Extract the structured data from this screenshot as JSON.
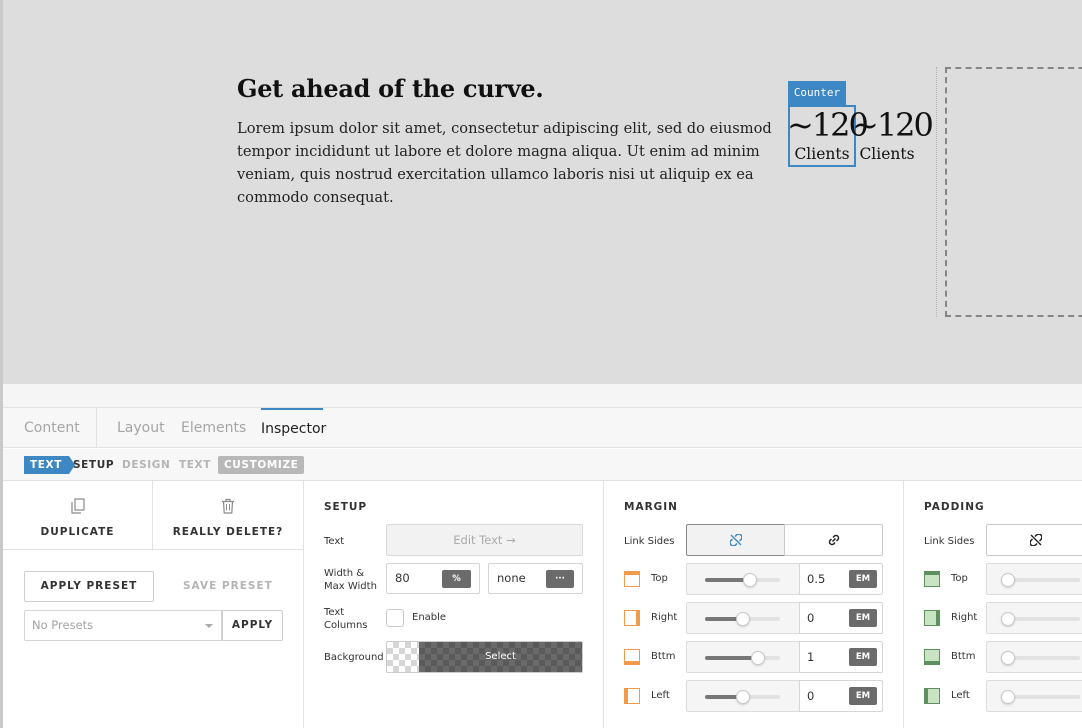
{
  "canvas": {
    "headline": "Get ahead of the curve.",
    "body": "Lorem ipsum dolor sit amet, consectetur adipiscing elit, sed do eiusmod tempor incididunt ut labore et dolore magna aliqua. Ut enim ad minim veniam, quis nostrud exercitation ullamco laboris nisi ut aliquip ex ea commodo consequat.",
    "selected_tag": "Counter",
    "counters": [
      {
        "number": "~120",
        "label": "Clients"
      },
      {
        "number": "~120",
        "label": "Clients"
      }
    ]
  },
  "tabs": [
    {
      "label": "Content"
    },
    {
      "label": "Layout"
    },
    {
      "label": "Elements"
    },
    {
      "label": "Inspector",
      "active": true
    }
  ],
  "breadcrumbs": {
    "text": "TEXT",
    "setup": "SETUP",
    "design": "DESIGN",
    "text2": "TEXT",
    "customize": "CUSTOMIZE"
  },
  "actions": {
    "duplicate": "DUPLICATE",
    "delete": "REALLY DELETE?",
    "apply_preset": "APPLY PRESET",
    "save_preset": "SAVE PRESET",
    "preset_placeholder": "No Presets",
    "apply": "APPLY"
  },
  "setup": {
    "title": "SETUP",
    "text_label": "Text",
    "edit_text": "Edit Text →",
    "width_label": "Width & Max Width",
    "width_value": "80",
    "width_unit": "%",
    "max_width_value": "none",
    "max_width_unit": "···",
    "columns_label": "Text Columns",
    "enable_label": "Enable",
    "enable_checked": false,
    "background_label": "Background",
    "background_select": "Select"
  },
  "margin": {
    "title": "MARGIN",
    "link_sides_label": "Link Sides",
    "linked": false,
    "sides": [
      {
        "label": "Top",
        "value": "0.5",
        "unit": "EM",
        "slider": 0.6
      },
      {
        "label": "Right",
        "value": "0",
        "unit": "EM",
        "slider": 0.5
      },
      {
        "label": "Bttm",
        "value": "1",
        "unit": "EM",
        "slider": 0.7
      },
      {
        "label": "Left",
        "value": "0",
        "unit": "EM",
        "slider": 0.5
      }
    ]
  },
  "padding": {
    "title": "PADDING",
    "link_sides_label": "Link Sides",
    "sides": [
      {
        "label": "Top"
      },
      {
        "label": "Right"
      },
      {
        "label": "Bttm"
      },
      {
        "label": "Left"
      }
    ]
  },
  "icons": {
    "duplicate": "copy-icon",
    "delete": "trash-icon",
    "unlink": "unlink-icon",
    "link": "link-icon"
  },
  "colors": {
    "accent": "#3d87c5",
    "margin_side": "#f09b4b",
    "padding_side": "#5e8f5e"
  }
}
